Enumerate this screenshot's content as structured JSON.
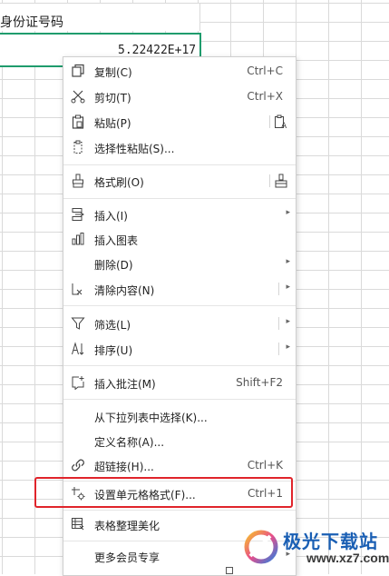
{
  "sheet": {
    "header_text": "身份证号码",
    "cell_value": "5.22422E+17"
  },
  "menu": {
    "items": [
      {
        "label": "复制(C)",
        "shortcut": "Ctrl+C",
        "icon": "copy-icon"
      },
      {
        "label": "剪切(T)",
        "shortcut": "Ctrl+X",
        "icon": "cut-icon"
      },
      {
        "label": "粘贴(P)",
        "icon": "paste-icon",
        "trail_icon": "paste-text-icon"
      },
      {
        "label": "选择性粘贴(S)...",
        "icon": "paste-special-icon"
      },
      {
        "label": "格式刷(O)",
        "icon": "format-painter-icon",
        "trail_icon": "format-painter-alt-icon"
      },
      {
        "label": "插入(I)",
        "icon": "insert-icon",
        "submenu": true
      },
      {
        "label": "插入图表",
        "icon": "chart-icon"
      },
      {
        "label": "删除(D)",
        "submenu": true
      },
      {
        "label": "清除内容(N)",
        "icon": "eraser-icon",
        "submenu": true
      },
      {
        "label": "筛选(L)",
        "icon": "filter-icon",
        "submenu": true
      },
      {
        "label": "排序(U)",
        "icon": "sort-icon",
        "submenu": true
      },
      {
        "label": "插入批注(M)",
        "shortcut": "Shift+F2",
        "icon": "comment-icon"
      },
      {
        "label": "从下拉列表中选择(K)..."
      },
      {
        "label": "定义名称(A)..."
      },
      {
        "label": "超链接(H)...",
        "shortcut": "Ctrl+K",
        "icon": "link-icon"
      },
      {
        "label": "设置单元格格式(F)...",
        "shortcut": "Ctrl+1",
        "icon": "format-cells-icon"
      },
      {
        "label": "表格整理美化",
        "icon": "table-beautify-icon"
      },
      {
        "label": "更多会员专享",
        "submenu": true
      }
    ]
  },
  "watermark": {
    "name": "极光下载站",
    "url": "www.xz7.com"
  },
  "colors": {
    "active_cell": "#1f9c6d",
    "highlight": "#e0242b",
    "watermark": "#1a5fb4"
  }
}
